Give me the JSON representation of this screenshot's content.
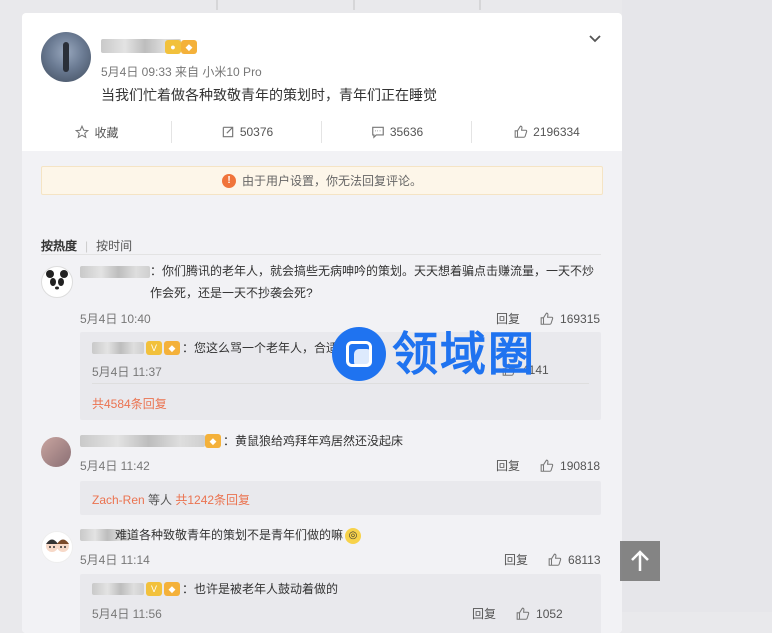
{
  "post": {
    "meta": "5月4日 09:33 来自 小米10 Pro",
    "text": "当我们忙着做各种致敬青年的策划时，青年们正在睡觉"
  },
  "actions": {
    "favorite_label": "收藏",
    "repost_count": "50376",
    "comment_count": "35636",
    "like_count": "2196334"
  },
  "notice": {
    "icon": "!",
    "text": "由于用户设置，你无法回复评论。"
  },
  "sort": {
    "by_hot": "按热度",
    "by_time": "按时间"
  },
  "comments": [
    {
      "text": "：你们腾讯的老年人，就会搞些无病呻吟的策划。天天想着骗点击赚流量，一天不炒作会死，还是一天不抄袭会死?",
      "time": "5月4日 10:40",
      "reply_label": "回复",
      "likes": "169315",
      "sub_reply": {
        "text": "：您这么骂一个老年人，合适么",
        "time": "5月4日 11:37",
        "likes": "4141"
      },
      "more": "共4584条回复"
    },
    {
      "text": "：黄鼠狼给鸡拜年鸡居然还没起床",
      "time": "5月4日 11:42",
      "reply_label": "回复",
      "likes": "190818",
      "more_user": "Zach-Ren",
      "more_mid": " 等人 ",
      "more": "共1242条回复"
    },
    {
      "text": "难道各种致敬青年的策划不是青年们做的嘛",
      "time": "5月4日 11:14",
      "reply_label": "回复",
      "likes": "68113",
      "sub_reply": {
        "text": "：也许是被老年人鼓动着做的",
        "time": "5月4日 11:56",
        "likes": "1052"
      }
    }
  ],
  "sub_reply_label": "回复",
  "watermark": "领域圈",
  "colors": {
    "accent": "#eb7350",
    "notice_bg": "#fdf6e9",
    "watermark": "#1f73f0"
  }
}
